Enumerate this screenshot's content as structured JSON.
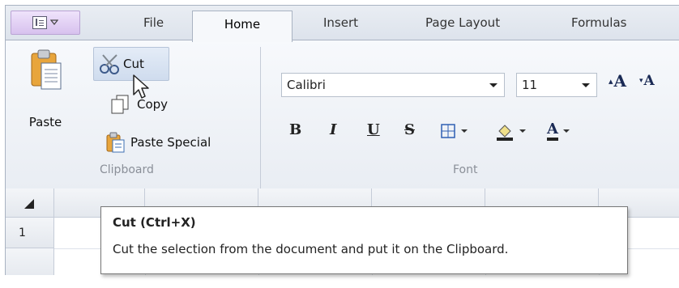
{
  "tabs": {
    "file": "File",
    "home": "Home",
    "insert": "Insert",
    "page_layout": "Page Layout",
    "formulas": "Formulas"
  },
  "clipboard": {
    "paste_label": "Paste",
    "cut_label": "Cut",
    "copy_label": "Copy",
    "paste_special_label": "Paste Special",
    "group_label": "Clipboard"
  },
  "font": {
    "font_name": "Calibri",
    "font_size": "11",
    "bold": "B",
    "italic": "I",
    "underline": "U",
    "strike": "S",
    "group_label": "Font",
    "grow_glyph": "A",
    "shrink_glyph": "A",
    "color_glyph": "A"
  },
  "grid": {
    "row_1": "1"
  },
  "tooltip": {
    "title": "Cut (Ctrl+X)",
    "body": "Cut the selection from the document and put it on the Clipboard."
  },
  "colors": {
    "accent_tab": "#f6f8fb",
    "cut_highlight": "#cfdcee",
    "quick_access": "#d7c1ee"
  }
}
